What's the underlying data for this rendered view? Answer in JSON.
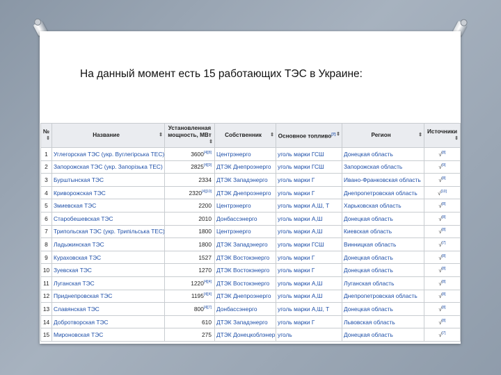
{
  "title": "На данный момент есть 15 работающих ТЭС в Украине:",
  "table": {
    "headers": [
      "№",
      "Название",
      "Установленная мощность, МВт",
      "Собственник",
      "Основное топливо",
      "Регион",
      "Источники"
    ],
    "header_sup_fuel": "[7]",
    "rows": [
      {
        "n": "1",
        "name": "Углегорская ТЭС (укр. Вуглегірська ТЕС)",
        "cap": "3600",
        "cap_ref": "[4][8]",
        "owner": "Центрэнерго",
        "fuel": "уголь марки ГСШ",
        "region": "Донецкая область",
        "src": "√",
        "src_ref": "[8]"
      },
      {
        "n": "2",
        "name": "Запорожская ТЭС (укр. Запорізька ТЕС)",
        "cap": "2825",
        "cap_ref": "[4][9]",
        "owner": "ДТЭК Днепроэнерго",
        "fuel": "уголь марки ГСШ",
        "region": "Запорожская область",
        "src": "√",
        "src_ref": "[9]"
      },
      {
        "n": "3",
        "name": "Бурштынская ТЭС",
        "cap": "2334",
        "cap_ref": "",
        "owner": "ДТЭК Западэнерго",
        "fuel": "уголь марки Г",
        "region": "Ивано-Франковская область",
        "src": "√",
        "src_ref": "[8]"
      },
      {
        "n": "4",
        "name": "Криворожская ТЭС",
        "cap": "2320",
        "cap_ref": "[4][10]",
        "owner": "ДТЭК Днепроэнерго",
        "fuel": "уголь марки Г",
        "region": "Днепропетровская область",
        "src": "√",
        "src_ref": "[10]"
      },
      {
        "n": "5",
        "name": "Змиевская ТЭС",
        "cap": "2200",
        "cap_ref": "",
        "owner": "Центрэнерго",
        "fuel": "уголь марки А,Ш, Т",
        "region": "Харьковская область",
        "src": "√",
        "src_ref": "[8]"
      },
      {
        "n": "6",
        "name": "Старобешевская ТЭС",
        "cap": "2010",
        "cap_ref": "",
        "owner": "Донбассэнерго",
        "fuel": "уголь марки А,Ш",
        "region": "Донецкая область",
        "src": "√",
        "src_ref": "[8]"
      },
      {
        "n": "7",
        "name": "Трипольская ТЭС (укр. Трипільська ТЕС)",
        "cap": "1800",
        "cap_ref": "",
        "owner": "Центрэнерго",
        "fuel": "уголь марки А,Ш",
        "region": "Киевская область",
        "src": "√",
        "src_ref": "[8]"
      },
      {
        "n": "8",
        "name": "Ладыжинская ТЭС",
        "cap": "1800",
        "cap_ref": "",
        "owner": "ДТЭК Западэнерго",
        "fuel": "уголь марки ГСШ",
        "region": "Винницкая область",
        "src": "√",
        "src_ref": "[7]"
      },
      {
        "n": "9",
        "name": "Кураховская ТЭС",
        "cap": "1527",
        "cap_ref": "",
        "owner": "ДТЭК Востокэнерго",
        "fuel": "уголь марки Г",
        "region": "Донецкая область",
        "src": "√",
        "src_ref": "[8]"
      },
      {
        "n": "10",
        "name": "Зуевская ТЭС",
        "cap": "1270",
        "cap_ref": "",
        "owner": "ДТЭК Востокэнерго",
        "fuel": "уголь марки Г",
        "region": "Донецкая область",
        "src": "√",
        "src_ref": "[8]"
      },
      {
        "n": "11",
        "name": "Луганская ТЭС",
        "cap": "1220",
        "cap_ref": "[4][4]",
        "owner": "ДТЭК Востокэнерго",
        "fuel": "уголь марки А,Ш",
        "region": "Луганская область",
        "src": "√",
        "src_ref": "[8]"
      },
      {
        "n": "12",
        "name": "Приднепровская ТЭС",
        "cap": "1195",
        "cap_ref": "[4][4]",
        "owner": "ДТЭК Днепроэнерго",
        "fuel": "уголь марки А,Ш",
        "region": "Днепропетровская область",
        "src": "√",
        "src_ref": "[8]"
      },
      {
        "n": "13",
        "name": "Славянская ТЭС",
        "cap": "800",
        "cap_ref": "[4][7]",
        "owner": "Донбассэнерго",
        "fuel": "уголь марки А,Ш, Т",
        "region": "Донецкая область",
        "src": "√",
        "src_ref": "[8]"
      },
      {
        "n": "14",
        "name": "Добротворская ТЭС",
        "cap": "610",
        "cap_ref": "",
        "owner": "ДТЭК Западэнерго",
        "fuel": "уголь марки Г",
        "region": "Львовская область",
        "src": "√",
        "src_ref": "[8]"
      },
      {
        "n": "15",
        "name": "Мироновская ТЭС",
        "cap": "275",
        "cap_ref": "",
        "owner": "ДТЭК Донецкоблэнерго",
        "fuel": "уголь",
        "region": "Донецкая область",
        "src": "√",
        "src_ref": "[7]"
      }
    ]
  }
}
